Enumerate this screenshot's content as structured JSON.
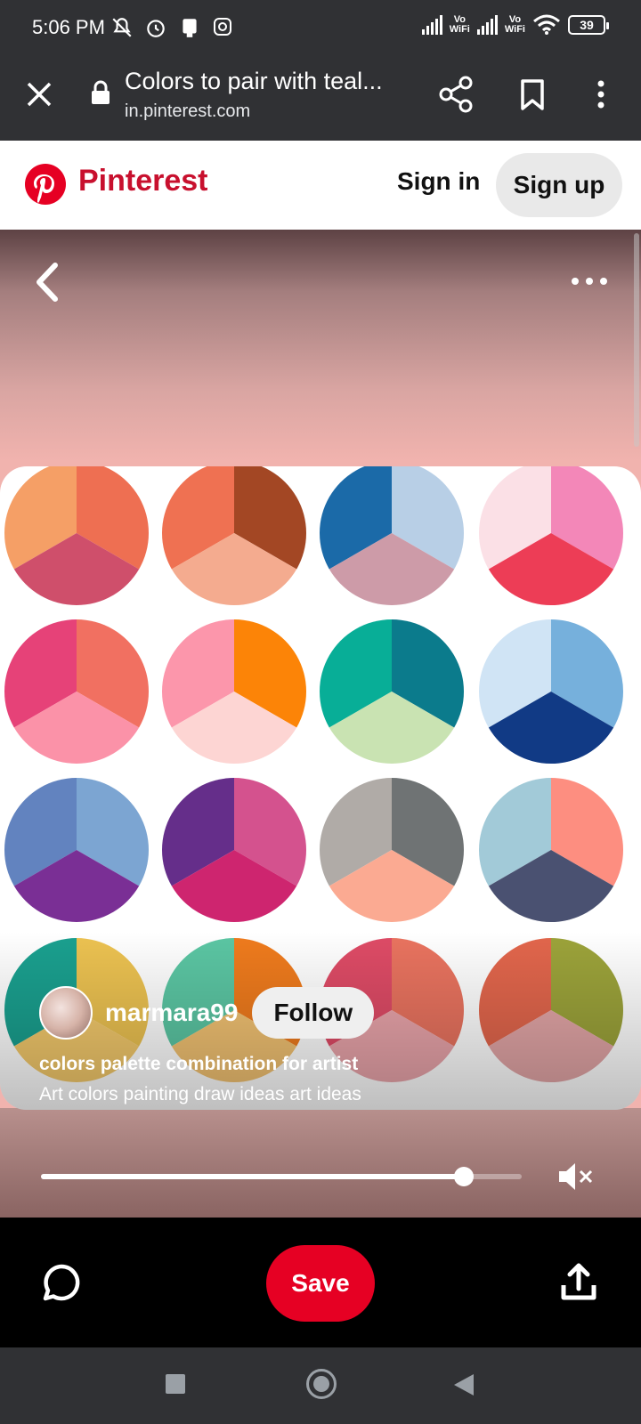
{
  "status_bar": {
    "time": "5:06 PM",
    "network_labels": [
      "Vo\nWiFi",
      "Vo\nWiFi"
    ],
    "battery": "39"
  },
  "tab": {
    "title": "Colors to pair with teal...",
    "url": "in.pinterest.com"
  },
  "site_header": {
    "brand": "Pinterest",
    "sign_in": "Sign in",
    "sign_up": "Sign up",
    "brand_color": "#e60023"
  },
  "pin": {
    "username": "marmara99",
    "follow_label": "Follow",
    "title": "colors palette combination for artist",
    "description": "Art colors painting draw ideas art ideas",
    "palettes": [
      [
        "#f59f66",
        "#ee6f52",
        "#cf4f6b"
      ],
      [
        "#ef7152",
        "#a34724",
        "#f4ab8f"
      ],
      [
        "#1b6aa8",
        "#b8cfe6",
        "#cd9ba8"
      ],
      [
        "#fbe0e6",
        "#f387b8",
        "#ed3d56"
      ],
      [
        "#e64278",
        "#f17061",
        "#fb92a8"
      ],
      [
        "#fc96ab",
        "#fc8407",
        "#fdd5d3"
      ],
      [
        "#08ae97",
        "#0b7b8c",
        "#c9e3b2"
      ],
      [
        "#d0e4f5",
        "#76b0dc",
        "#113a85"
      ],
      [
        "#6283bf",
        "#7ca5d2",
        "#7a2f95"
      ],
      [
        "#652e8a",
        "#d4528e",
        "#ce256f"
      ],
      [
        "#b0aba7",
        "#6f7374",
        "#fbaa92"
      ],
      [
        "#a2cad8",
        "#fd8e80",
        "#4a5171"
      ],
      [
        "#1aa08f",
        "#ecc251",
        "#f3c96b"
      ],
      [
        "#5bc6a3",
        "#ef7b1d",
        "#f2c272"
      ],
      [
        "#de4b66",
        "#e9735f",
        "#e9a4aa"
      ],
      [
        "#e2664c",
        "#9ca33a",
        "#e2a5a6"
      ]
    ]
  },
  "video": {
    "progress": 0.88,
    "muted": true
  },
  "actions": {
    "save_label": "Save"
  },
  "icons": {
    "close": "close-icon",
    "lock": "lock-icon",
    "share": "share-icon",
    "bookmark": "bookmark-icon",
    "menu": "kebab-menu-icon",
    "back": "chevron-left-icon",
    "more": "more-dots-icon",
    "mute": "speaker-muted-icon",
    "comment": "comment-icon",
    "upload": "upload-share-icon"
  }
}
